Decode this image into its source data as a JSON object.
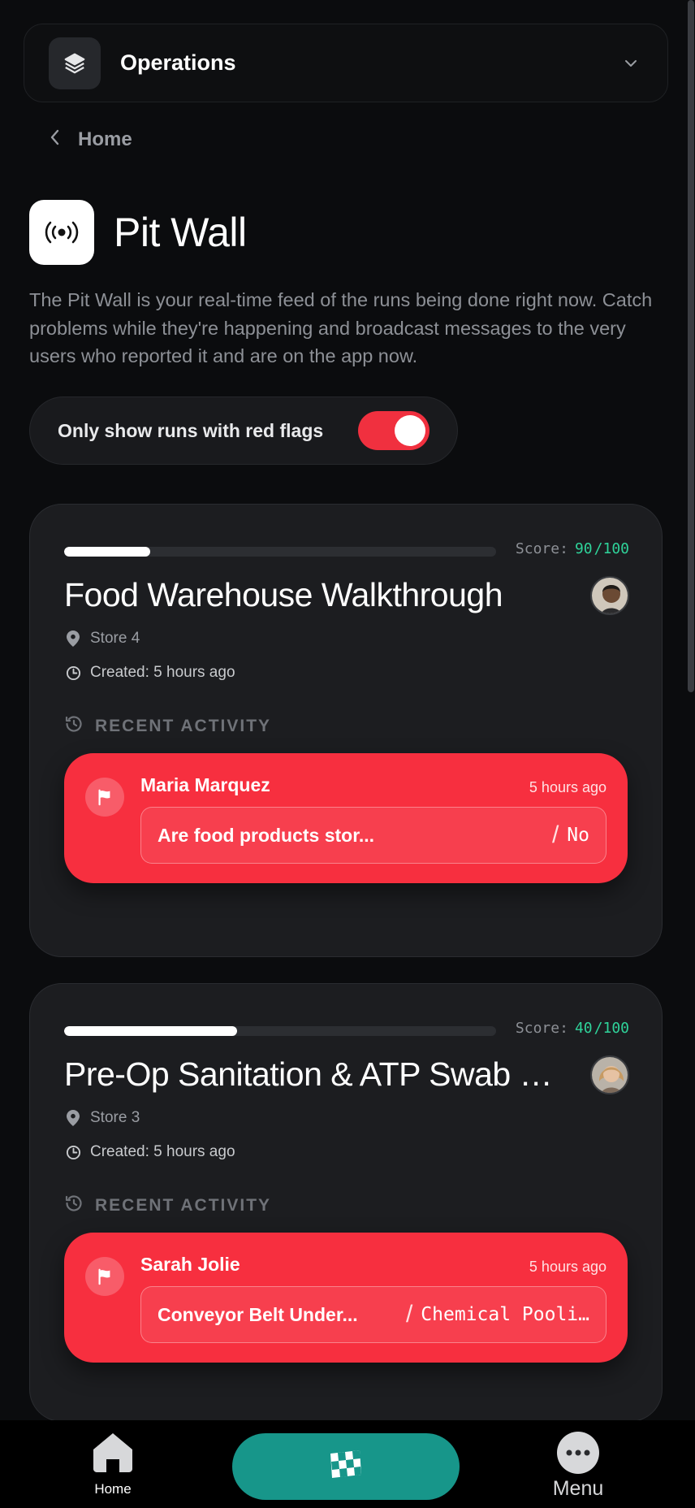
{
  "workspace": {
    "name": "Operations"
  },
  "breadcrumb": {
    "label": "Home"
  },
  "header": {
    "title": "Pit Wall"
  },
  "description": "The Pit Wall is your real-time feed of the runs being done right now. Catch problems while they're happening and broadcast messages to the very users who reported it and are on the app now.",
  "filter": {
    "label": "Only show runs with red flags",
    "enabled": true
  },
  "runs": [
    {
      "title": "Food Warehouse Walkthrough",
      "score_label": "Score:",
      "score": "90",
      "score_max": "/100",
      "progress": 0.2,
      "store": "Store 4",
      "created": "Created: 5 hours ago",
      "activity_heading": "RECENT ACTIVITY",
      "activity": {
        "user": "Maria Marquez",
        "time": "5 hours ago",
        "question": "Are food products stor...",
        "answer": "No"
      }
    },
    {
      "title": "Pre-Op Sanitation & ATP Swab C...",
      "score_label": "Score:",
      "score": "40",
      "score_max": "/100",
      "progress": 0.4,
      "store": "Store 3",
      "created": "Created: 5 hours ago",
      "activity_heading": "RECENT ACTIVITY",
      "activity": {
        "user": "Sarah Jolie",
        "time": "5 hours ago",
        "question": "Conveyor Belt Under...",
        "answer": "Chemical Pooli…"
      }
    }
  ],
  "nav": {
    "home_label": "Home",
    "menu_label": "Menu"
  },
  "colors": {
    "flag_red": "#f72f3f",
    "score_green": "#2fd39a",
    "nav_teal": "#17968a"
  }
}
